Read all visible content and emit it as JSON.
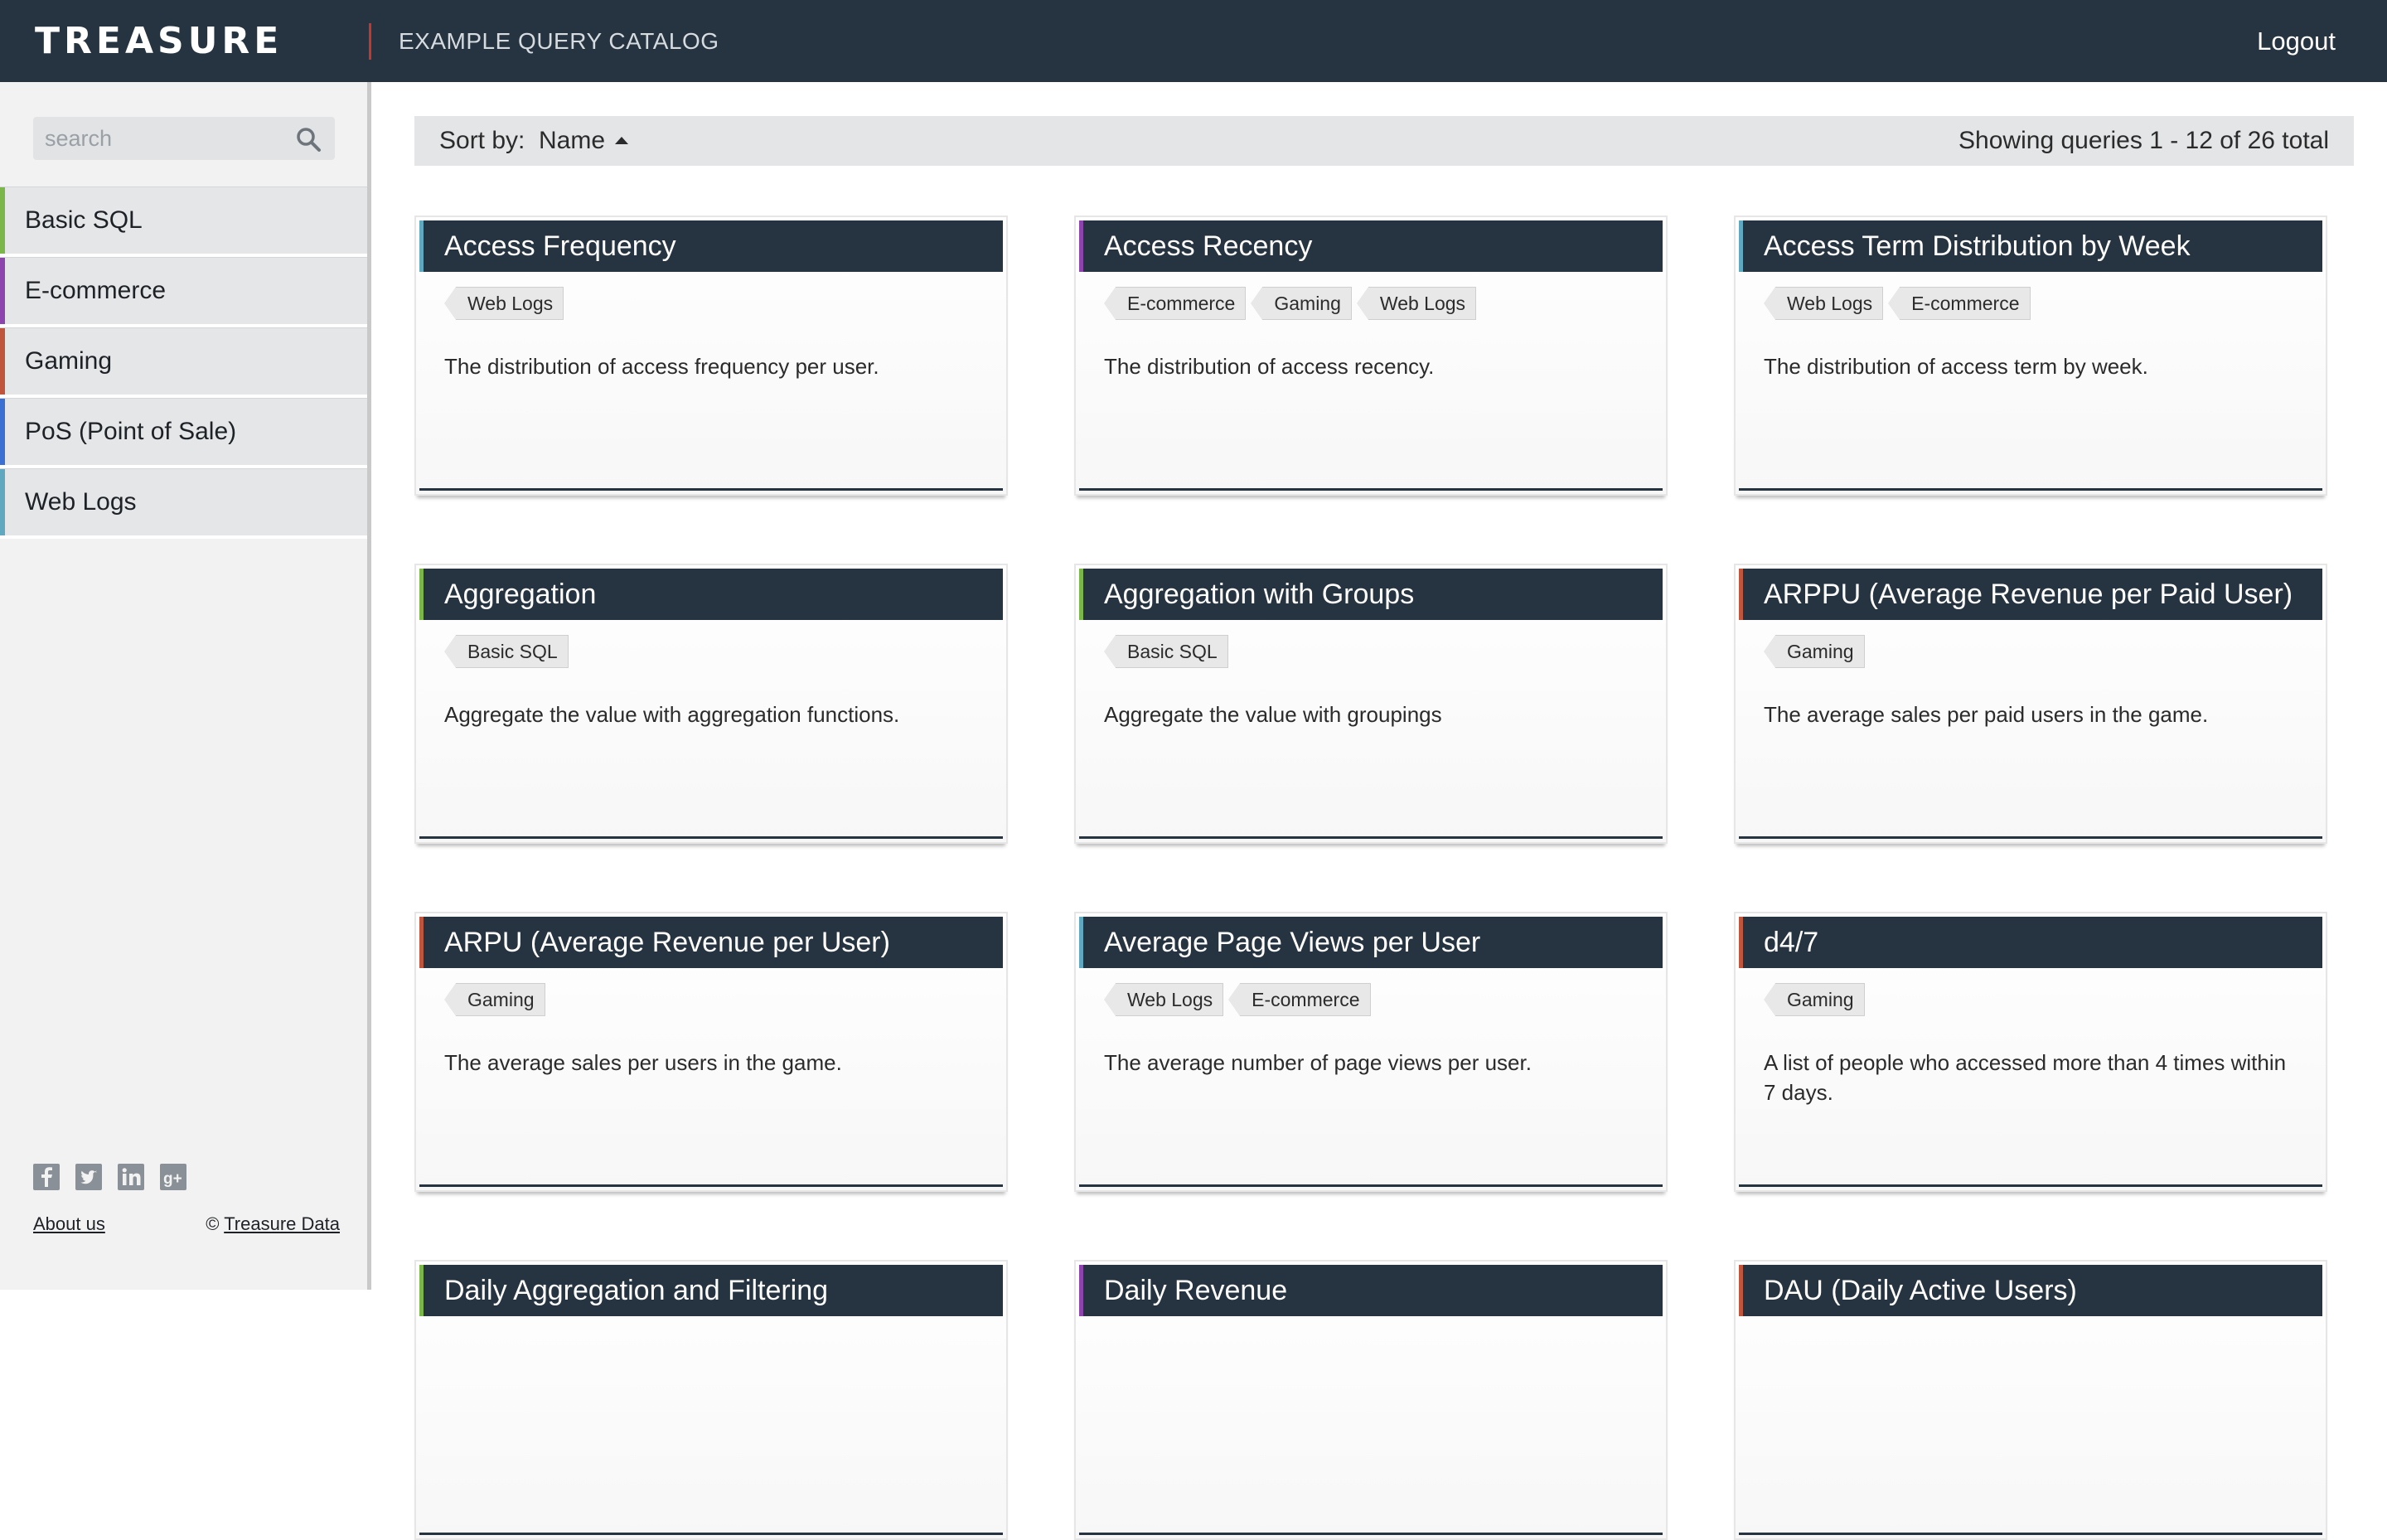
{
  "header": {
    "logo": "TREASURE",
    "catalog_title": "EXAMPLE QUERY CATALOG",
    "logout": "Logout",
    "background": "#263340",
    "divider_color": "#c8352c"
  },
  "sidebar": {
    "search_placeholder": "search",
    "categories": [
      {
        "label": "Basic SQL",
        "color": "#7ab648"
      },
      {
        "label": "E-commerce",
        "color": "#8e44ad"
      },
      {
        "label": "Gaming",
        "color": "#c0553d"
      },
      {
        "label": "PoS (Point of Sale)",
        "color": "#3b6fd1"
      },
      {
        "label": "Web Logs",
        "color": "#5fa8c0"
      }
    ],
    "social_icons": [
      "facebook-icon",
      "twitter-icon",
      "linkedin-icon",
      "google-plus-icon"
    ],
    "about_link": "About us",
    "copyright_symbol": "©",
    "copyright_link": "Treasure Data"
  },
  "sortbar": {
    "label": "Sort by:",
    "value": "Name",
    "showing": "Showing queries 1 - 12 of 26 total"
  },
  "cards": [
    {
      "title": "Access Frequency",
      "accent": "#5fa8c0",
      "tags": [
        "Web Logs"
      ],
      "description": "The distribution of access frequency per user."
    },
    {
      "title": "Access Recency",
      "accent": "#8e44ad",
      "tags": [
        "E-commerce",
        "Gaming",
        "Web Logs"
      ],
      "description": "The distribution of access recency."
    },
    {
      "title": "Access Term Distribution by Week",
      "accent": "#5fa8c0",
      "tags": [
        "Web Logs",
        "E-commerce"
      ],
      "description": "The distribution of access term by week."
    },
    {
      "title": "Aggregation",
      "accent": "#7ab648",
      "tags": [
        "Basic SQL"
      ],
      "description": "Aggregate the value with aggregation functions."
    },
    {
      "title": "Aggregation with Groups",
      "accent": "#7ab648",
      "tags": [
        "Basic SQL"
      ],
      "description": "Aggregate the value with groupings"
    },
    {
      "title": "ARPPU (Average Revenue per Paid User)",
      "accent": "#c0553d",
      "tags": [
        "Gaming"
      ],
      "description": "The average sales per paid users in the game."
    },
    {
      "title": "ARPU (Average Revenue per User)",
      "accent": "#c0553d",
      "tags": [
        "Gaming"
      ],
      "description": "The average sales per users in the game."
    },
    {
      "title": "Average Page Views per User",
      "accent": "#5fa8c0",
      "tags": [
        "Web Logs",
        "E-commerce"
      ],
      "description": "The average number of page views per user."
    },
    {
      "title": "d4/7",
      "accent": "#c0553d",
      "tags": [
        "Gaming"
      ],
      "description": "A list of people who accessed more than 4 times within 7 days."
    },
    {
      "title": "Daily Aggregation and Filtering",
      "accent": "#7ab648",
      "tags": [],
      "description": ""
    },
    {
      "title": "Daily Revenue",
      "accent": "#8e44ad",
      "tags": [],
      "description": ""
    },
    {
      "title": "DAU (Daily Active Users)",
      "accent": "#c0553d",
      "tags": [],
      "description": ""
    }
  ]
}
